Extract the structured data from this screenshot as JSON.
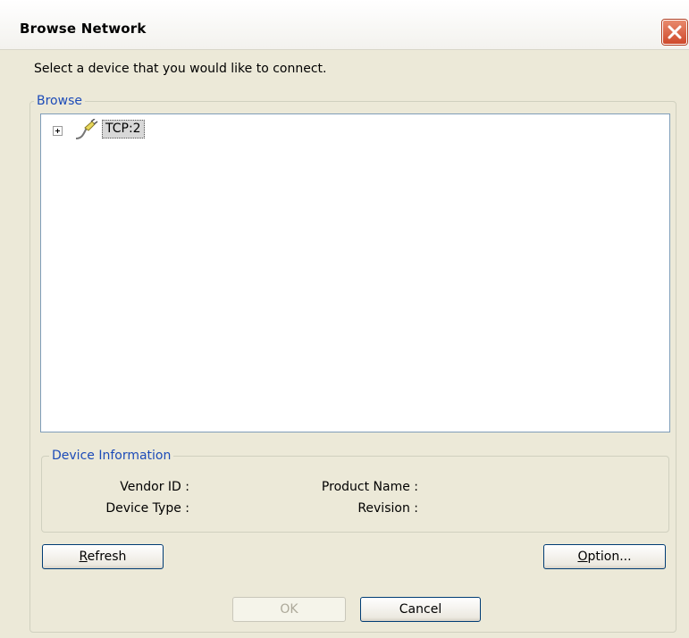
{
  "window": {
    "title": "Browse Network"
  },
  "prompt": "Select a device that you would like to connect.",
  "browse": {
    "legend": "Browse",
    "tree": [
      {
        "label": "TCP:2",
        "expanded": false,
        "selected": true
      }
    ]
  },
  "device_info": {
    "legend": "Device Information",
    "vendor_id_label": "Vendor ID :",
    "device_type_label": "Device Type :",
    "product_name_label": "Product Name :",
    "revision_label": "Revision :"
  },
  "buttons": {
    "refresh_key": "R",
    "refresh_rest": "efresh",
    "option_key": "O",
    "option_rest": "ption...",
    "ok": "OK",
    "cancel": "Cancel"
  },
  "icons": {
    "close": "close-icon",
    "expand": "plus-expander-icon",
    "network": "network-plug-icon"
  },
  "colors": {
    "accent": "#1c4bb8",
    "close_button": "#cf4a2c"
  }
}
